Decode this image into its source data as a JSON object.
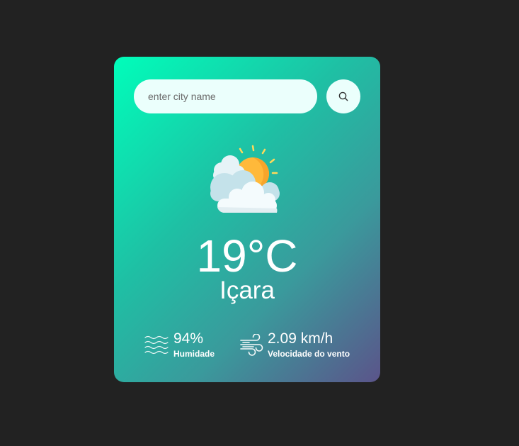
{
  "search": {
    "placeholder": "enter city name",
    "value": "",
    "button_icon": "search-icon"
  },
  "weather": {
    "condition_icon": "sun-behind-clouds-icon",
    "temperature": "19°C",
    "city": "Içara"
  },
  "details": {
    "humidity": {
      "icon": "humidity-waves-icon",
      "value": "94%",
      "label": "Humidade"
    },
    "wind": {
      "icon": "wind-icon",
      "value": "2.09 km/h",
      "label": "Velocidade do vento"
    }
  },
  "colors": {
    "page_background": "#222222",
    "card_gradient_start": "#00feba",
    "card_gradient_end": "#5b548a",
    "input_background": "#ebfffc",
    "text": "#ffffff"
  }
}
